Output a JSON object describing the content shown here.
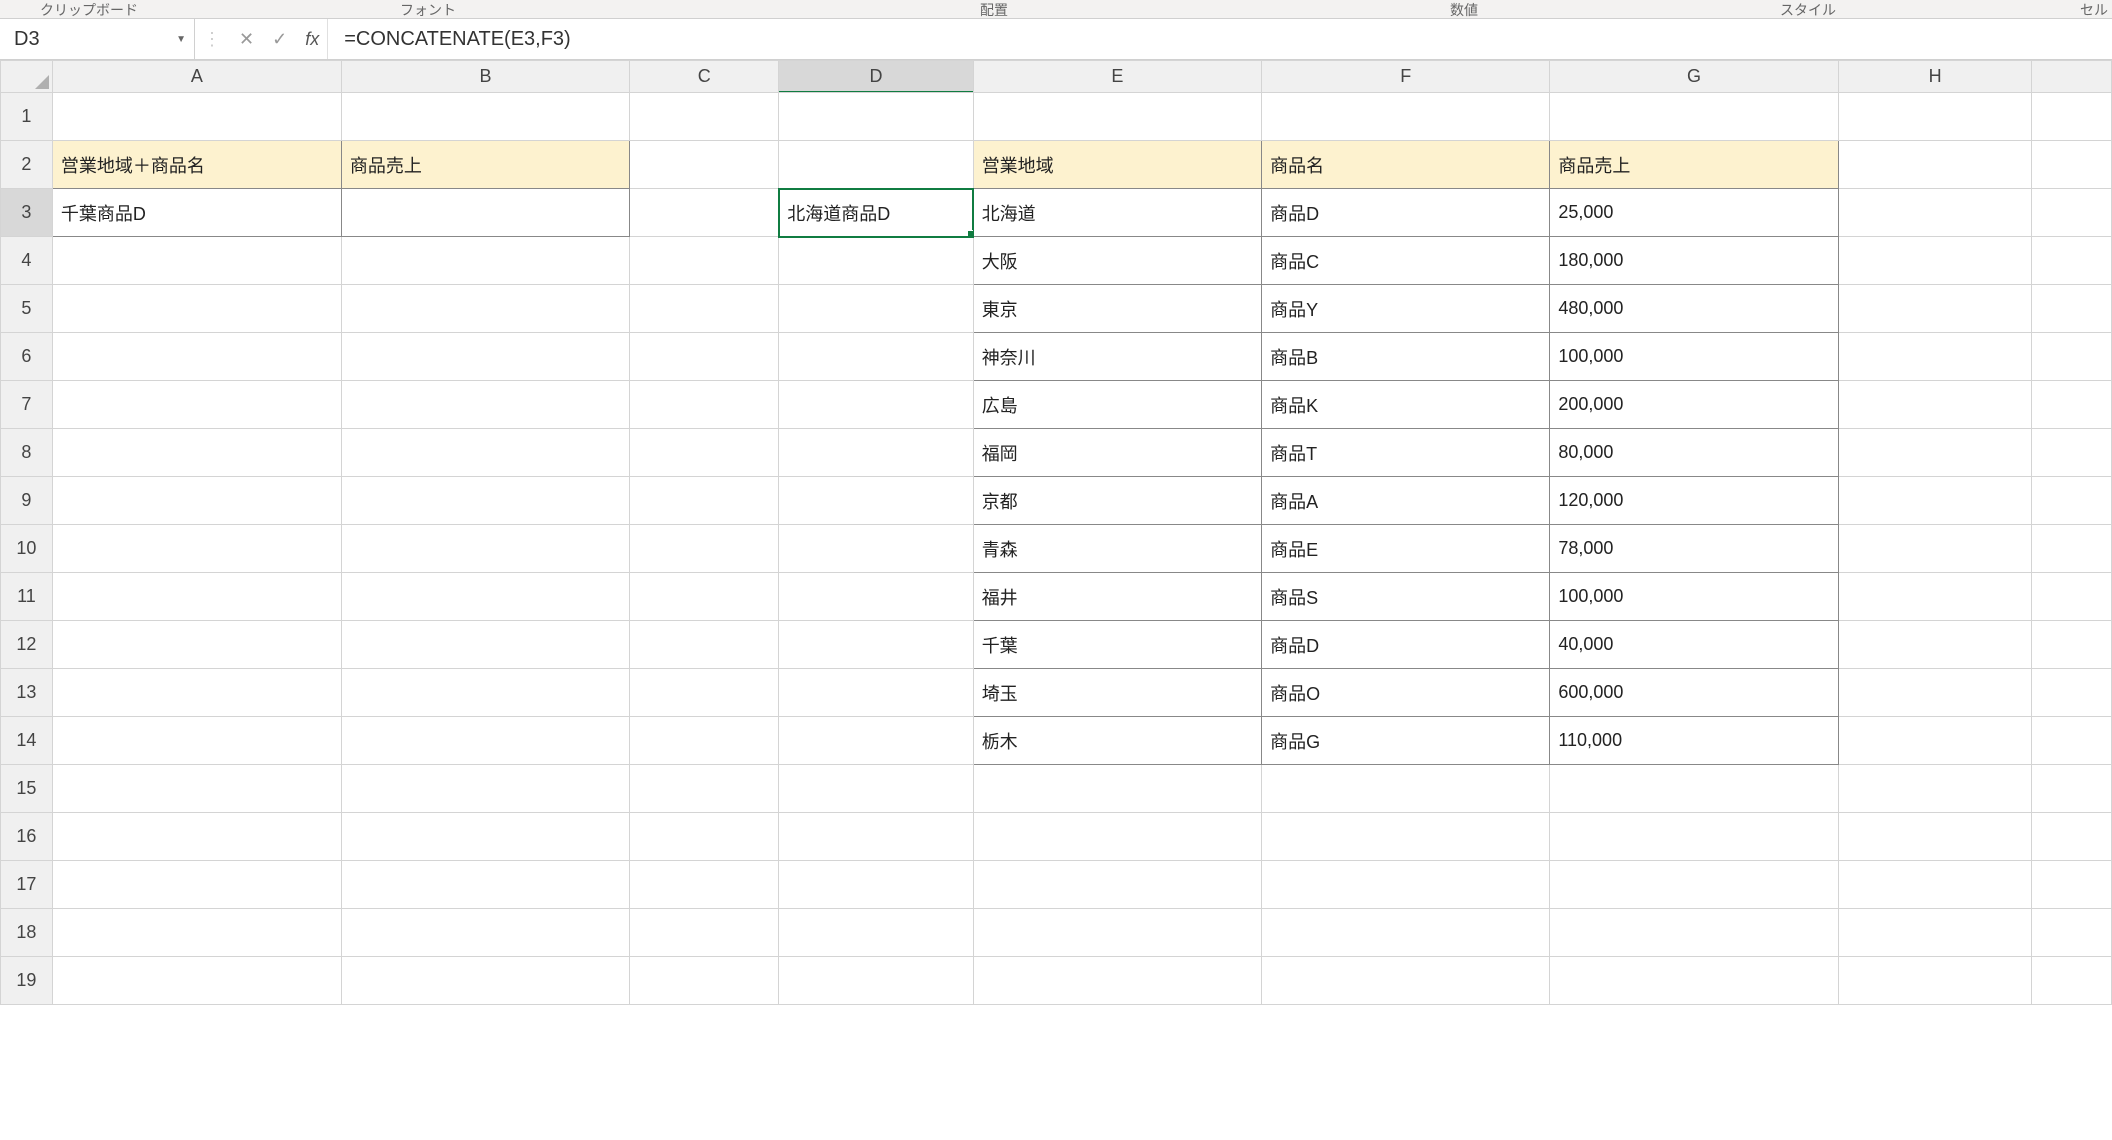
{
  "ribbon": {
    "clipboard": "クリップボード",
    "font": "フォント",
    "alignment": "配置",
    "number": "数値",
    "styles": "スタイル",
    "cells": "セル"
  },
  "formula_bar": {
    "name_box": "D3",
    "cancel": "✕",
    "enter": "✓",
    "fx": "fx",
    "formula": "=CONCATENATE(E3,F3)"
  },
  "columns": [
    "A",
    "B",
    "C",
    "D",
    "E",
    "F",
    "G",
    "H"
  ],
  "left_table": {
    "header1": "営業地域＋商品名",
    "header2": "商品売上",
    "a3": "千葉商品D"
  },
  "cell_d3": "北海道商品D",
  "right_table": {
    "header_e": "営業地域",
    "header_f": "商品名",
    "header_g": "商品売上",
    "rows": [
      {
        "e": "北海道",
        "f": "商品D",
        "g": "25,000"
      },
      {
        "e": "大阪",
        "f": "商品C",
        "g": "180,000"
      },
      {
        "e": "東京",
        "f": "商品Y",
        "g": "480,000"
      },
      {
        "e": "神奈川",
        "f": "商品B",
        "g": "100,000"
      },
      {
        "e": "広島",
        "f": "商品K",
        "g": "200,000"
      },
      {
        "e": "福岡",
        "f": "商品T",
        "g": "80,000"
      },
      {
        "e": "京都",
        "f": "商品A",
        "g": "120,000"
      },
      {
        "e": "青森",
        "f": "商品E",
        "g": "78,000"
      },
      {
        "e": "福井",
        "f": "商品S",
        "g": "100,000"
      },
      {
        "e": "千葉",
        "f": "商品D",
        "g": "40,000"
      },
      {
        "e": "埼玉",
        "f": "商品O",
        "g": "600,000"
      },
      {
        "e": "栃木",
        "f": "商品G",
        "g": "110,000"
      }
    ]
  },
  "selected_col": "D",
  "selected_row": 3,
  "visible_rows": 19
}
